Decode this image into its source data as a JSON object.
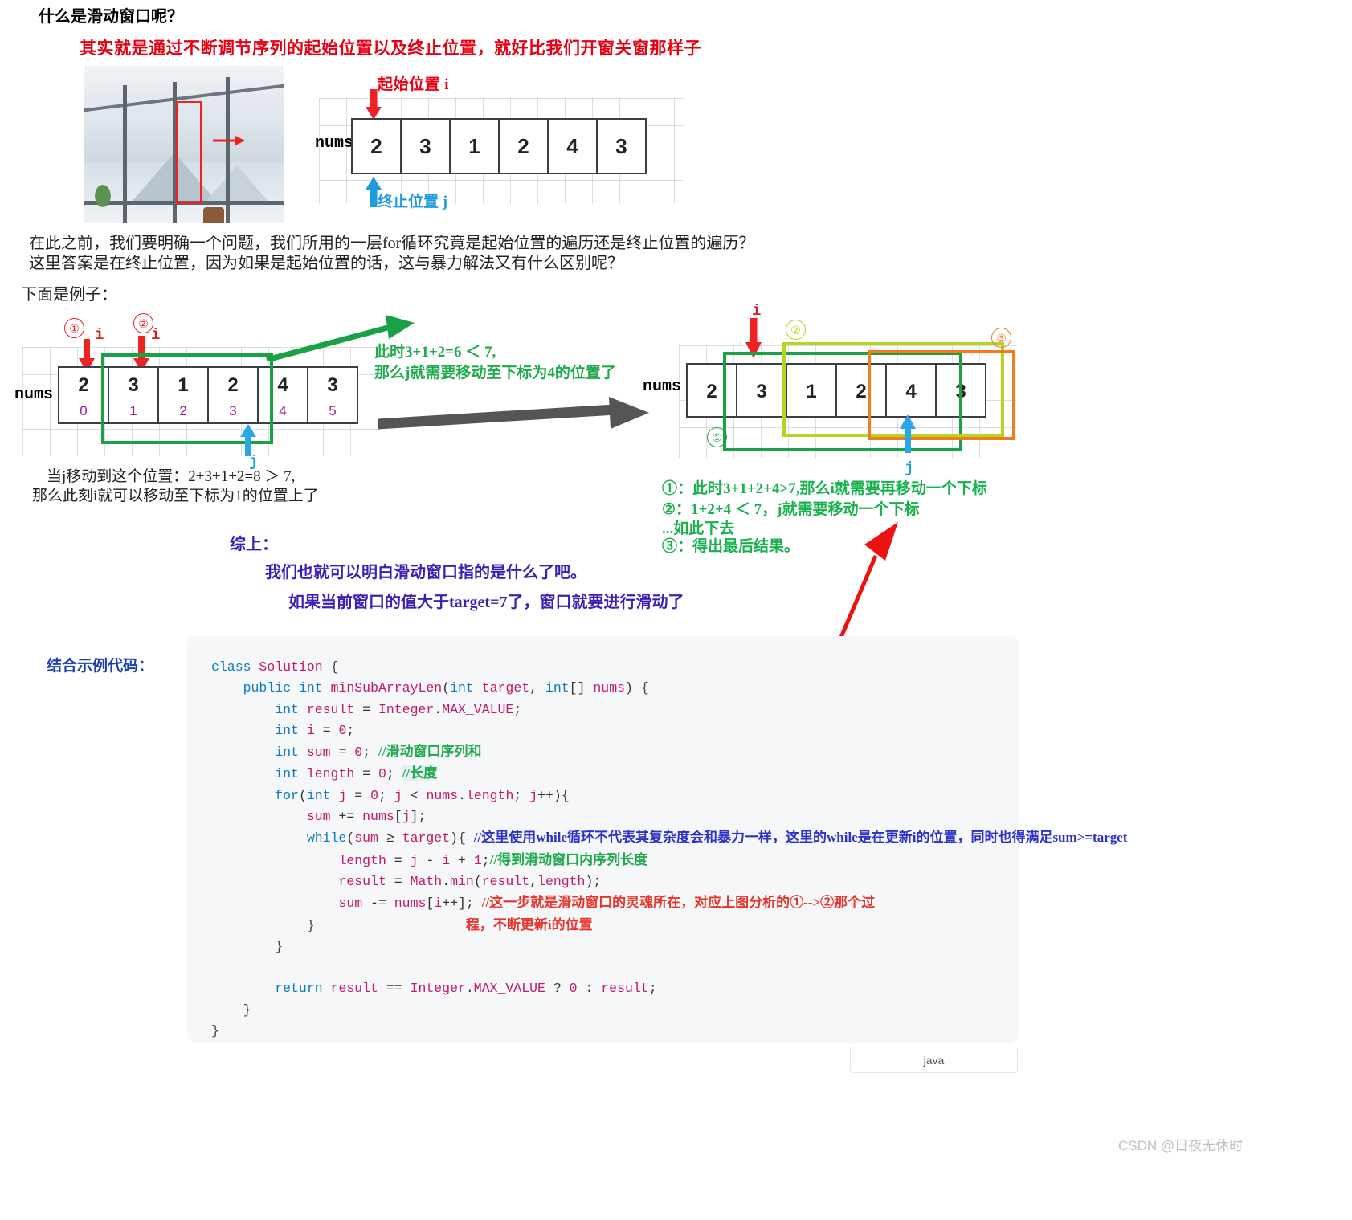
{
  "page": {
    "title": "什么是滑动窗口呢？",
    "subtitle_red": "其实就是通过不断调节序列的起始位置以及终止位置，就好比我们开窗关窗那样子",
    "paragraph_line1": "在此之前，我们要明确一个问题，我们所用的一层for循环究竟是起始位置的遍历还是终止位置的遍历？",
    "paragraph_line2": "这里答案是在终止位置，因为如果是起始位置的话，这与暴力解法又有什么区别呢？",
    "example_intro": "下面是例子："
  },
  "top_diagram": {
    "array_label": "nums",
    "values": [
      "2",
      "3",
      "1",
      "2",
      "4",
      "3"
    ],
    "start_label": "起始位置 i",
    "end_label": "终止位置 j"
  },
  "left_diagram": {
    "array_label": "nums",
    "values": [
      "2",
      "3",
      "1",
      "2",
      "4",
      "3"
    ],
    "indices": [
      "0",
      "1",
      "2",
      "3",
      "4",
      "5"
    ],
    "marker_1": "①",
    "marker_2": "②",
    "i_label_1": "i",
    "i_label_2": "i",
    "j_label": "j",
    "note_line1": "当j移动到这个位置：2+3+1+2=8 ＞ 7,",
    "note_line2": "那么此刻i就可以移动至下标为1的位置上了"
  },
  "transition": {
    "line1": "此时3+1+2=6 ＜ 7,",
    "line2": "那么j就需要移动至下标为4的位置了"
  },
  "right_diagram": {
    "array_label": "nums",
    "values": [
      "2",
      "3",
      "1",
      "2",
      "4",
      "3"
    ],
    "marker_1": "①",
    "marker_2": "②",
    "marker_3": "③",
    "i_label": "i",
    "j_label": "j",
    "notes": [
      "①：此时3+1+2+4>7,那么i就需要再移动一个下标",
      "②：1+2+4 ＜ 7，j就需要移动一个下标",
      "...如此下去",
      "③：得出最后结果。"
    ]
  },
  "summary": {
    "heading": "综上：",
    "line1": "我们也就可以明白滑动窗口指的是什么了吧。",
    "line2": "如果当前窗口的值大于target=7了，窗口就要进行滑动了"
  },
  "code_section": {
    "label": "结合示例代码：",
    "language_tag": "java",
    "lines": [
      "class Solution {",
      "    public int minSubArrayLen(int target, int[] nums) {",
      "        int result = Integer.MAX_VALUE;",
      "        int i = 0;",
      "        int sum = 0; //滑动窗口序列和",
      "        int length = 0; //长度",
      "        for(int j = 0; j < nums.length; j++){",
      "            sum += nums[j];",
      "            while(sum >= target){ //这里使用while循环不代表其复杂度会和暴力一样，这里的while是在更新i的位置，同时也得满足sum>=target",
      "                length = j - i + 1;//得到滑动窗口内序列长度",
      "                result = Math.min(result,length);",
      "                sum -= nums[i++]; //这一步就是滑动窗口的灵魂所在，对应上图分析的①-->②那个过",
      "            }                      程，不断更新i的位置",
      "        }",
      "",
      "        return result == Integer.MAX_VALUE ? 0 : result;",
      "    }",
      "}"
    ],
    "comments": {
      "c_sum": "//滑动窗口序列和",
      "c_length": "//长度",
      "c_while": "//这里使用while循环不代表其复杂度会和暴力一样，这里的while是在更新i的位置，同时也得满足sum>=target",
      "c_len2": "//得到滑动窗口内序列长度",
      "c_soul": "//这一步就是滑动窗口的灵魂所在，对应上图分析的①-->②那个过",
      "c_soul2": "程，不断更新i的位置"
    }
  },
  "watermark": "CSDN @日夜无休时",
  "colors": {
    "red": "#e60012",
    "green": "#1faa4b",
    "yellow_green": "#b5d621",
    "orange": "#f47a20",
    "blue": "#1e9bdd",
    "purple": "#3d1fb5",
    "index_purple": "#9b1c8e",
    "code_bg": "#f6f7f9"
  }
}
